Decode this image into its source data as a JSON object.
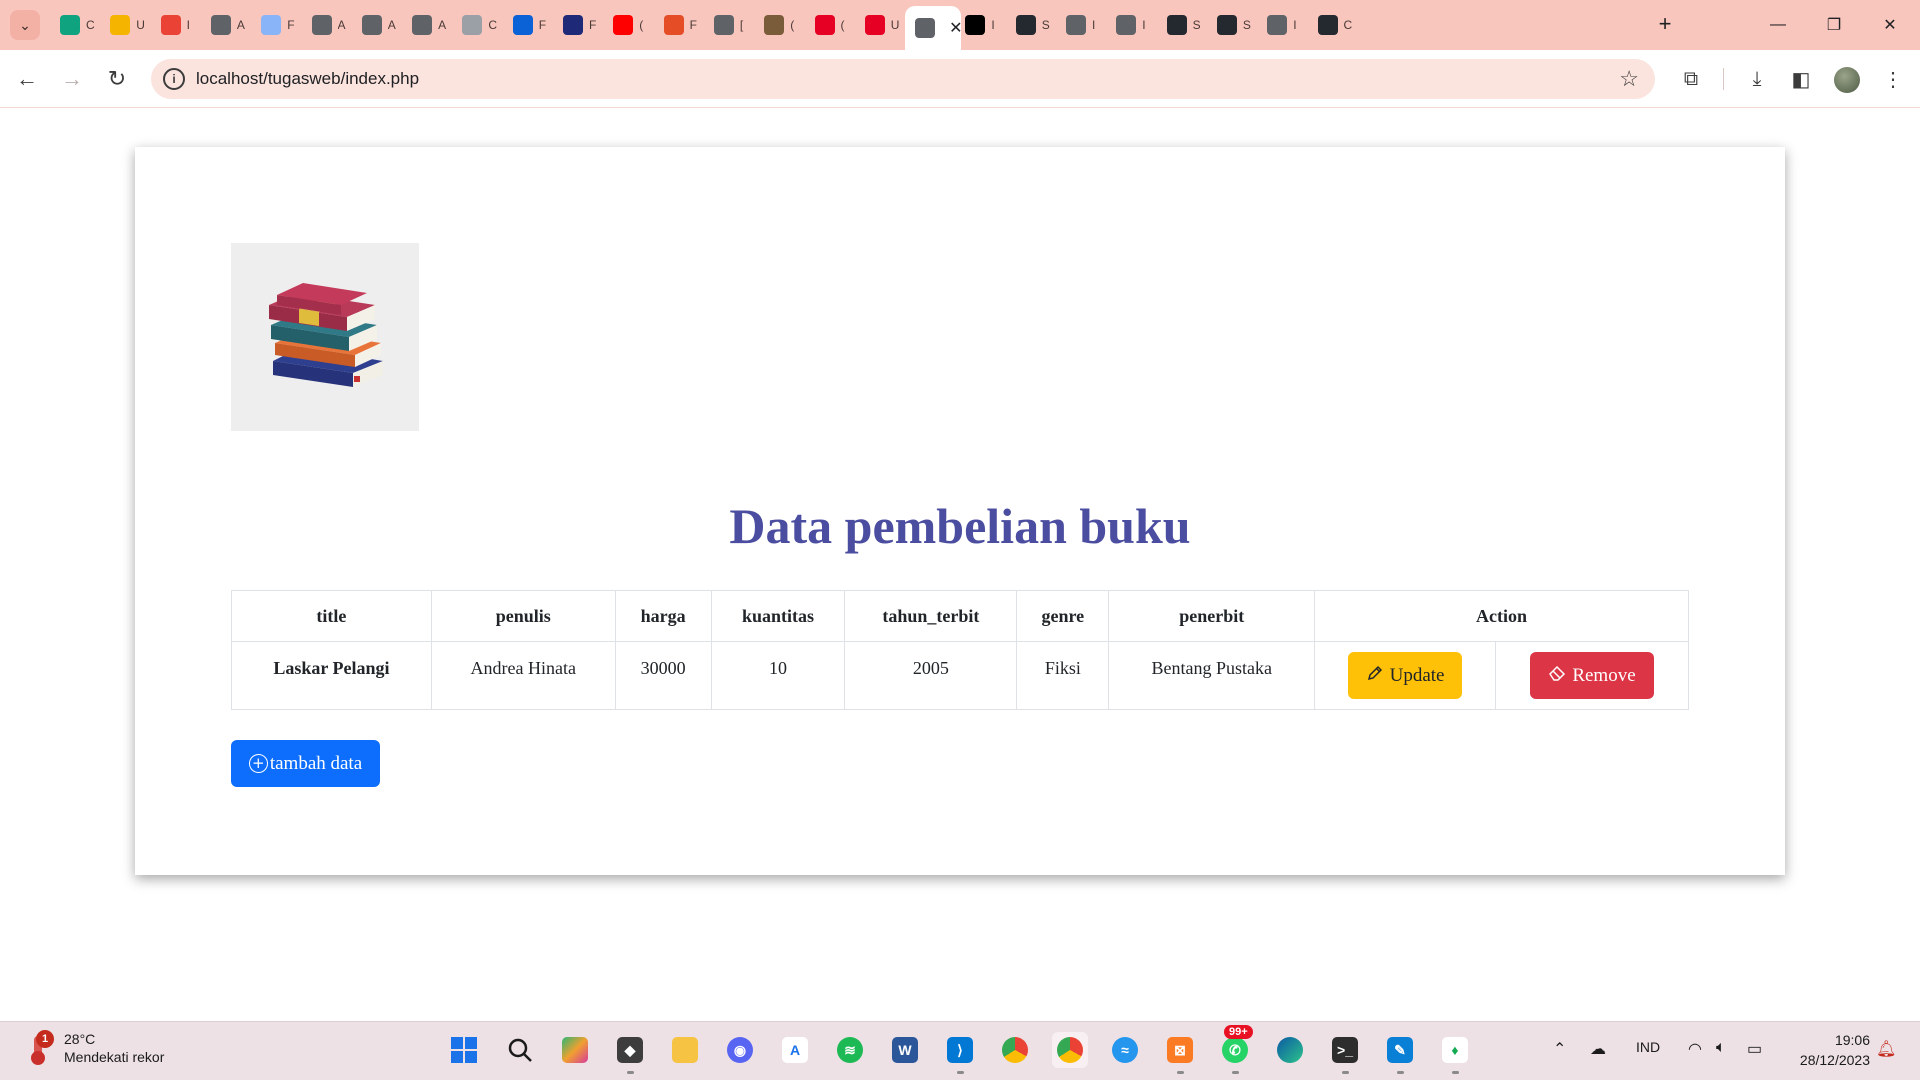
{
  "browser": {
    "tabs": [
      {
        "icon": "openai-icon",
        "title": "C",
        "color": "#10a37f"
      },
      {
        "icon": "slides-icon",
        "title": "U",
        "color": "#f4b400"
      },
      {
        "icon": "gmail-icon",
        "title": "I",
        "color": "#ea4335"
      },
      {
        "icon": "globe-icon",
        "title": "A",
        "color": "#5f6368"
      },
      {
        "icon": "docs-icon",
        "title": "F",
        "color": "#8ab4f8"
      },
      {
        "icon": "globe-icon",
        "title": "A",
        "color": "#5f6368"
      },
      {
        "icon": "globe-icon",
        "title": "A",
        "color": "#5f6368"
      },
      {
        "icon": "globe-icon",
        "title": "A",
        "color": "#5f6368"
      },
      {
        "icon": "cisco-icon",
        "title": "C",
        "color": "#9aa0a6"
      },
      {
        "icon": "power-automate-icon",
        "title": "F",
        "color": "#0b61d6"
      },
      {
        "icon": "feather-icon",
        "title": "F",
        "color": "#1e2a78"
      },
      {
        "icon": "youtube-icon",
        "title": "(",
        "color": "#ff0000"
      },
      {
        "icon": "html-icon",
        "title": "F",
        "color": "#e44d26"
      },
      {
        "icon": "download-icon",
        "title": "[",
        "color": "#5f6368"
      },
      {
        "icon": "avatar-icon",
        "title": "(",
        "color": "#7a5b3a"
      },
      {
        "icon": "pinterest-icon",
        "title": "(",
        "color": "#e60023"
      },
      {
        "icon": "block-icon",
        "title": "U",
        "color": "#e60023"
      },
      {
        "icon": "globe-icon",
        "title": "/",
        "color": "#5f6368"
      },
      {
        "icon": "triangle-icon",
        "title": "I",
        "color": "#000000"
      },
      {
        "icon": "github-icon",
        "title": "S",
        "color": "#24292f"
      },
      {
        "icon": "globe-icon",
        "title": "I",
        "color": "#5f6368"
      },
      {
        "icon": "globe-icon",
        "title": "I",
        "color": "#5f6368"
      },
      {
        "icon": "github-icon",
        "title": "S",
        "color": "#24292f"
      },
      {
        "icon": "github-icon",
        "title": "S",
        "color": "#24292f"
      },
      {
        "icon": "globe-icon",
        "title": "I",
        "color": "#5f6368"
      },
      {
        "icon": "github-icon",
        "title": "C",
        "color": "#24292f"
      }
    ],
    "url": "localhost/tugasweb/index.php"
  },
  "page": {
    "title": "Data pembelian buku",
    "table": {
      "headers": [
        "title",
        "penulis",
        "harga",
        "kuantitas",
        "tahun_terbit",
        "genre",
        "penerbit",
        "Action"
      ],
      "rows": [
        {
          "title": "Laskar Pelangi",
          "penulis": "Andrea Hinata",
          "harga": "30000",
          "kuantitas": "10",
          "tahun_terbit": "2005",
          "genre": "Fiksi",
          "penerbit": "Bentang Pustaka"
        }
      ]
    },
    "buttons": {
      "update": "Update",
      "remove": "Remove",
      "add": "tambah data"
    },
    "colors": {
      "title": "#4b4ea0",
      "update": "#ffc107",
      "remove": "#dc3545",
      "add": "#0d6efd"
    }
  },
  "taskbar": {
    "weather": {
      "badge": "1",
      "temp": "28°C",
      "condition": "Mendekati rekor"
    },
    "notifications": "99+",
    "language": "IND",
    "time": "19:06",
    "date": "28/12/2023"
  }
}
